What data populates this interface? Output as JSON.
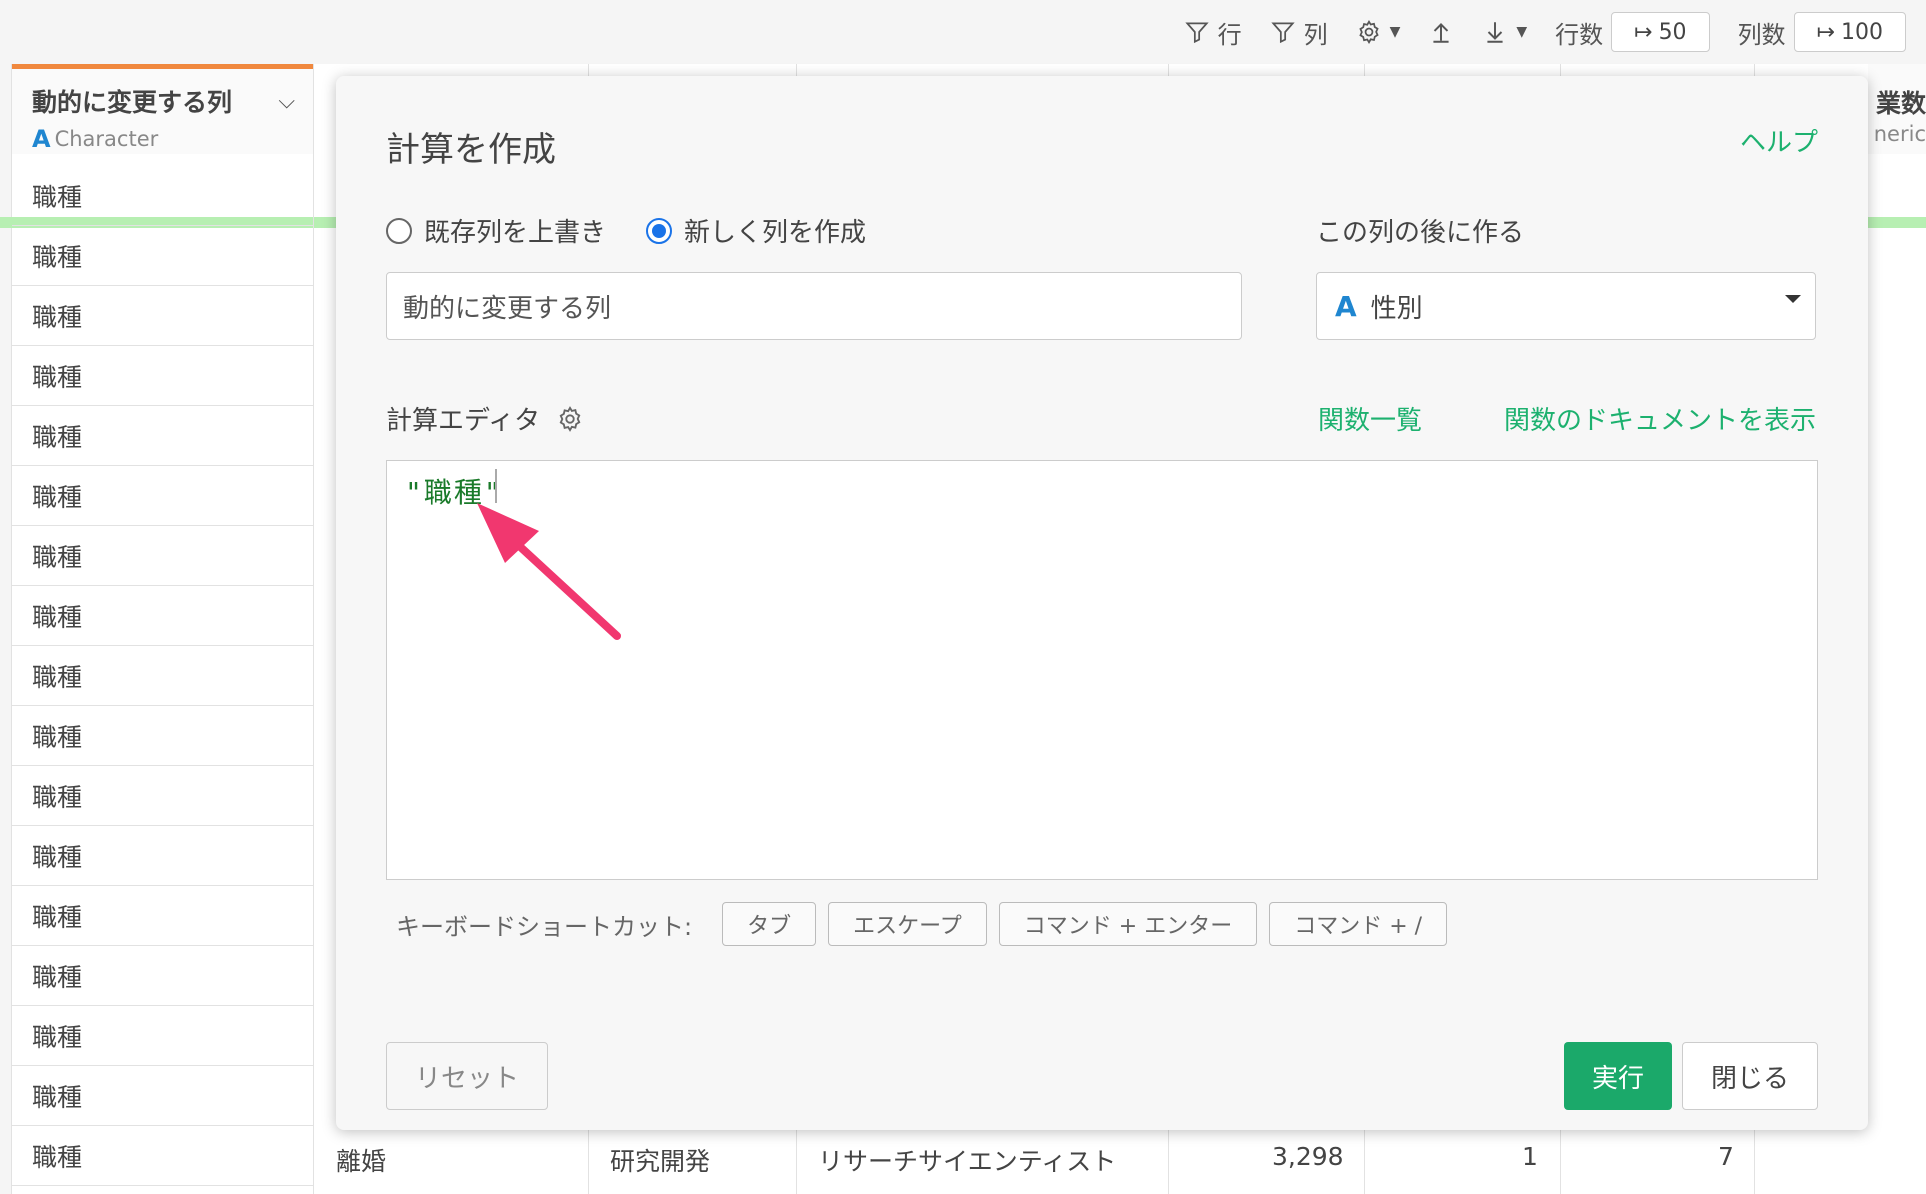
{
  "toolbar": {
    "filter_row": "行",
    "filter_col": "列",
    "rows_label": "行数",
    "rows_value": "50",
    "cols_label": "列数",
    "cols_value": "100"
  },
  "grid": {
    "column_title": "動的に変更する列",
    "column_type": "Character",
    "right_header_title": "業数",
    "right_header_type": "neric",
    "cells": [
      "職種",
      "職種",
      "職種",
      "職種",
      "職種",
      "職種",
      "職種",
      "職種",
      "職種",
      "職種",
      "職種",
      "職種",
      "職種",
      "職種",
      "職種",
      "職種",
      "職種"
    ],
    "bottom_row": {
      "marital": "離婚",
      "department": "研究開発",
      "role": "リサーチサイエンティスト",
      "value1": "3,298",
      "value2": "1",
      "value3": "7"
    }
  },
  "modal": {
    "title": "計算を作成",
    "help": "ヘルプ",
    "radio_overwrite": "既存列を上書き",
    "radio_new": "新しく列を作成",
    "after_label": "この列の後に作る",
    "column_name_value": "動的に変更する列",
    "after_select_value": "性別",
    "editor_label": "計算エディタ",
    "function_list": "関数一覧",
    "function_docs": "関数のドキュメントを表示",
    "code": "\"職種\"",
    "shortcut_label": "キーボードショートカット:",
    "shortcuts": [
      "タブ",
      "エスケープ",
      "コマンド + エンター",
      "コマンド + /"
    ],
    "reset": "リセット",
    "run": "実行",
    "close": "閉じる"
  }
}
